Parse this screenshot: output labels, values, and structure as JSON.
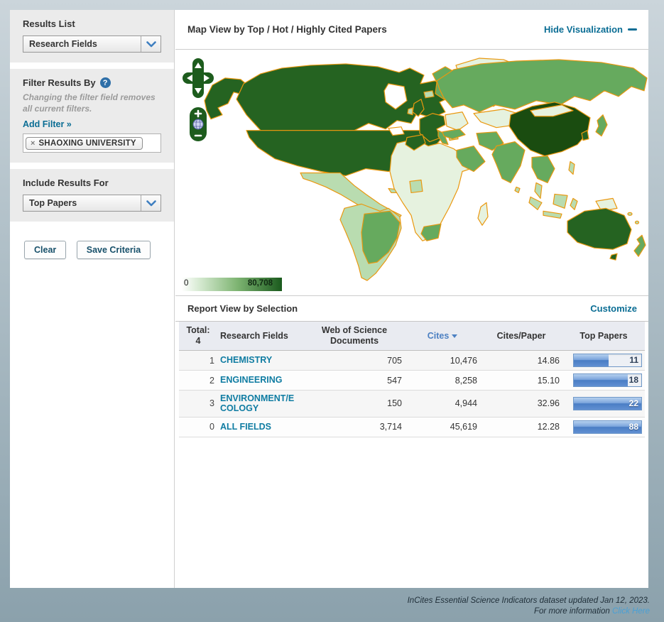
{
  "sidebar": {
    "results_list": {
      "label": "Results List",
      "selected": "Research Fields"
    },
    "filter": {
      "label": "Filter Results By",
      "help_icon": "?",
      "note": "Changing the filter field removes all current filters.",
      "add_filter_link": "Add Filter »",
      "tags": [
        {
          "remove_glyph": "×",
          "label": "SHAOXING UNIVERSITY"
        }
      ]
    },
    "include_results": {
      "label": "Include Results For",
      "selected": "Top Papers"
    },
    "buttons": {
      "clear": "Clear",
      "save": "Save Criteria"
    }
  },
  "map": {
    "title": "Map View by Top / Hot / Highly Cited Papers",
    "hide_link": "Hide Visualization",
    "legend": {
      "min": "0",
      "max": "80,708"
    },
    "palette": {
      "none": "#e6f2df",
      "low": "#b9dcb0",
      "mid": "#66aa5e",
      "high": "#256321",
      "max": "#1a4c10",
      "border": "#ea980f"
    },
    "controls": {
      "zoom_in": "+",
      "zoom_out": "−"
    }
  },
  "report": {
    "title": "Report View by Selection",
    "customize_link": "Customize",
    "table": {
      "total_label": "Total:",
      "total_value": "4",
      "columns": {
        "field": "Research Fields",
        "wos": "Web of Science Documents",
        "cites": "Cites",
        "cpp": "Cites/Paper",
        "top": "Top Papers"
      },
      "sorted_column": "Cites",
      "sort_direction": "desc",
      "rows": [
        {
          "rank": "1",
          "field": "CHEMISTRY",
          "wos": "705",
          "cites": "10,476",
          "cpp": "14.86",
          "top": "11",
          "bar_pct": 52
        },
        {
          "rank": "2",
          "field": "ENGINEERING",
          "wos": "547",
          "cites": "8,258",
          "cpp": "15.10",
          "top": "18",
          "bar_pct": 80
        },
        {
          "rank": "3",
          "field": "ENVIRONMENT/ECOLOGY",
          "wos": "150",
          "cites": "4,944",
          "cpp": "32.96",
          "top": "22",
          "bar_pct": 100
        },
        {
          "rank": "0",
          "field": "ALL FIELDS",
          "wos": "3,714",
          "cites": "45,619",
          "cpp": "12.28",
          "top": "88",
          "bar_pct": 100
        }
      ]
    }
  },
  "footer": {
    "line1": "InCites Essential Science Indicators dataset updated Jan 12, 2023.",
    "line2_prefix": "For more information ",
    "line2_link": "Click Here"
  }
}
